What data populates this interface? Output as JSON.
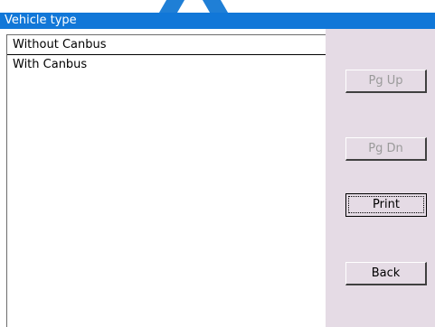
{
  "window": {
    "title": "Vehicle type"
  },
  "list": {
    "items": [
      {
        "label": "Without Canbus",
        "selected": true
      },
      {
        "label": "With Canbus",
        "selected": false
      }
    ]
  },
  "buttons": {
    "pg_up": {
      "label": "Pg Up",
      "enabled": false
    },
    "pg_dn": {
      "label": "Pg Dn",
      "enabled": false
    },
    "print": {
      "label": "Print",
      "enabled": true,
      "focused": true
    },
    "back": {
      "label": "Back",
      "enabled": true
    }
  },
  "colors": {
    "titlebar": "#1177d8",
    "panel": "#e5dbe5"
  }
}
